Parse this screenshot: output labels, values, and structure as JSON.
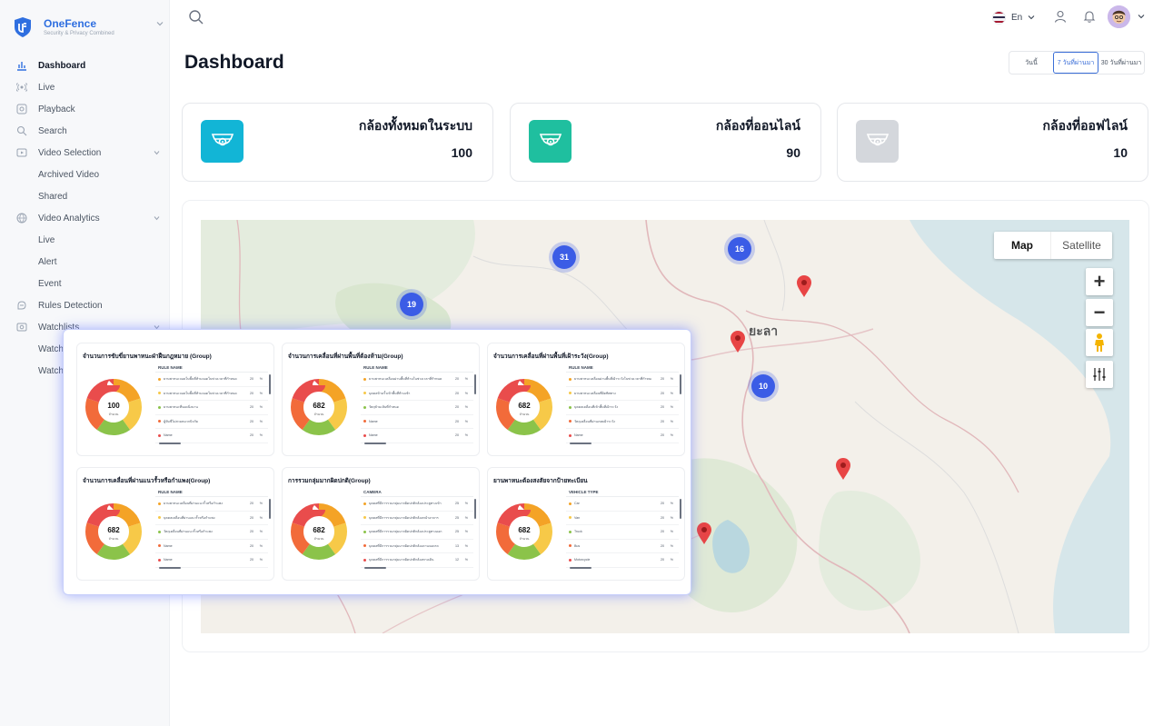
{
  "brand": {
    "name": "OneFence",
    "tagline": "Security & Privacy Combined"
  },
  "sidebar": {
    "items": [
      {
        "label": "Dashboard",
        "icon": "bar-chart-icon",
        "active": true
      },
      {
        "label": "Live",
        "icon": "broadcast-icon"
      },
      {
        "label": "Playback",
        "icon": "playback-icon"
      },
      {
        "label": "Search",
        "icon": "search-icon"
      },
      {
        "label": "Video Selection",
        "icon": "video-selection-icon",
        "expandable": true
      },
      {
        "label": "Archived Video",
        "sub": true
      },
      {
        "label": "Shared",
        "sub": true
      },
      {
        "label": "Video Analytics",
        "icon": "analytics-icon",
        "expandable": true
      },
      {
        "label": "Live",
        "sub": true
      },
      {
        "label": "Alert",
        "sub": true
      },
      {
        "label": "Event",
        "sub": true
      },
      {
        "label": "Rules Detection",
        "icon": "rules-icon"
      },
      {
        "label": "Watchlists",
        "icon": "watchlist-icon",
        "expandable": true
      },
      {
        "label": "Watch",
        "sub": true
      },
      {
        "label": "Watch",
        "sub": true
      }
    ]
  },
  "header": {
    "language": "En"
  },
  "page": {
    "title": "Dashboard"
  },
  "range": {
    "options": [
      "วันนี้",
      "7 วันที่ผ่านมา",
      "30 วันที่ผ่านมา"
    ],
    "selected": 1
  },
  "stats": [
    {
      "label": "กล้องทั้งหมดในระบบ",
      "value": "100",
      "color": "#12b5d6"
    },
    {
      "label": "กล้องที่ออนไลน์",
      "value": "90",
      "color": "#1fbf9f"
    },
    {
      "label": "กล้องที่ออฟไลน์",
      "value": "10",
      "color": "#d4d7dc"
    }
  ],
  "map": {
    "toggle": [
      "Map",
      "Satellite"
    ],
    "city": "ยะลา",
    "clusters": [
      "31",
      "16",
      "19",
      "10"
    ],
    "zoom_in": "+",
    "zoom_out": "−"
  },
  "overlay": {
    "cards": [
      {
        "title": "จำนวนการขับขี่ยานพาหนะฝ่าฝืนกฎหมาย (Group)",
        "column": "RULE NAME",
        "center_value": "100",
        "center_unit": "จำนวน",
        "rows": [
          {
            "name": "ยานพาหนะจอดในพื้นที่ห้ามจอดในช่วงเวลาที่กำหนด",
            "count": "20",
            "pct": "%",
            "color": "#f4a326"
          },
          {
            "name": "ยานพาหนะจอดในพื้นที่ห้ามจอดในช่วงเวลาที่กำหนด",
            "count": "20",
            "pct": "%",
            "color": "#f7c948"
          },
          {
            "name": "ยานพาหนะที่จอดนิ่งนาน",
            "count": "20",
            "pct": "%",
            "color": "#8bc34a"
          },
          {
            "name": "ผู้ขับขี่ไม่สวมหมวกนิรภัย",
            "count": "20",
            "pct": "%",
            "color": "#f26b3a"
          },
          {
            "name": "Name",
            "count": "20",
            "pct": "%",
            "color": "#e94c4c"
          }
        ]
      },
      {
        "title": "จำนวนการเคลื่อนที่ผ่านพื้นที่ต้องห้าม(Group)",
        "column": "RULE NAME",
        "center_value": "682",
        "center_unit": "จำนวน",
        "rows": [
          {
            "name": "ยานพาหนะเคลื่อนผ่านพื้นที่ห้ามในช่วงเวลาที่กำหนด",
            "count": "20",
            "pct": "%",
            "color": "#f4a326"
          },
          {
            "name": "บุคคลข้ามรั้วเข้าพื้นที่ห้ามเข้า",
            "count": "20",
            "pct": "%",
            "color": "#f7c948"
          },
          {
            "name": "วัตถุข้ามเส้นที่กำหนด",
            "count": "20",
            "pct": "%",
            "color": "#8bc34a"
          },
          {
            "name": "Name",
            "count": "20",
            "pct": "%",
            "color": "#f26b3a"
          },
          {
            "name": "Name",
            "count": "20",
            "pct": "%",
            "color": "#e94c4c"
          }
        ]
      },
      {
        "title": "จำนวนการเคลื่อนที่ผ่านพื้นที่เฝ้าระวัง(Group)",
        "column": "RULE NAME",
        "center_value": "682",
        "center_unit": "จำนวน",
        "rows": [
          {
            "name": "ยานพาหนะเคลื่อนผ่านพื้นที่เฝ้าระวังในช่วงเวลาที่กำหนด",
            "count": "20",
            "pct": "%",
            "color": "#f4a326"
          },
          {
            "name": "ยานพาหนะเคลื่อนที่ผิดทิศทาง",
            "count": "20",
            "pct": "%",
            "color": "#f7c948"
          },
          {
            "name": "บุคคลเคลื่อนที่เข้าพื้นที่เฝ้าระวัง",
            "count": "20",
            "pct": "%",
            "color": "#8bc34a"
          },
          {
            "name": "วัตถุเคลื่อนที่ผ่านเขตเฝ้าระวัง",
            "count": "20",
            "pct": "%",
            "color": "#f26b3a"
          },
          {
            "name": "Name",
            "count": "20",
            "pct": "%",
            "color": "#e94c4c"
          }
        ]
      },
      {
        "title": "จำนวนการเคลื่อนที่ผ่านแนวรั้วหรือกำแพง(Group)",
        "column": "RULE NAME",
        "center_value": "682",
        "center_unit": "จำนวน",
        "rows": [
          {
            "name": "ยานพาหนะเคลื่อนที่ผ่านแนวรั้วหรือกำแพง",
            "count": "20",
            "pct": "%",
            "color": "#f4a326"
          },
          {
            "name": "บุคคลเคลื่อนที่ผ่านแนวรั้วหรือกำแพง",
            "count": "20",
            "pct": "%",
            "color": "#f7c948"
          },
          {
            "name": "วัตถุเคลื่อนที่ผ่านแนวรั้วหรือกำแพง",
            "count": "20",
            "pct": "%",
            "color": "#8bc34a"
          },
          {
            "name": "Name",
            "count": "20",
            "pct": "%",
            "color": "#f26b3a"
          },
          {
            "name": "Name",
            "count": "20",
            "pct": "%",
            "color": "#e94c4c"
          }
        ]
      },
      {
        "title": "การรวมกลุ่มมากผิดปกติ(Group)",
        "column": "CAMERA",
        "center_value": "682",
        "center_unit": "จำนวน",
        "rows": [
          {
            "name": "บุคคลที่มีการรวมกลุ่มมากผิดปกติกล้องประตูทางเข้า",
            "count": "25",
            "pct": "%",
            "color": "#f4a326"
          },
          {
            "name": "บุคคลที่มีการรวมกลุ่มมากผิดปกติกล้องหน้าอาคาร",
            "count": "25",
            "pct": "%",
            "color": "#f7c948"
          },
          {
            "name": "บุคคลที่มีการรวมกลุ่มมากผิดปกติกล้องประตูทางออก",
            "count": "25",
            "pct": "%",
            "color": "#8bc34a"
          },
          {
            "name": "บุคคลที่มีการรวมกลุ่มมากผิดปกติกล้องลานจอดรถ",
            "count": "13",
            "pct": "%",
            "color": "#f26b3a"
          },
          {
            "name": "บุคคลที่มีการรวมกลุ่มมากผิดปกติกล้องทางเดิน",
            "count": "12",
            "pct": "%",
            "color": "#e94c4c"
          }
        ]
      },
      {
        "title": "ยานพาหนะต้องสงสัยจากป้ายทะเบียน",
        "column": "VEHICLE TYPE",
        "center_value": "682",
        "center_unit": "จำนวน",
        "rows": [
          {
            "name": "Car",
            "count": "20",
            "pct": "%",
            "color": "#f4a326"
          },
          {
            "name": "Van",
            "count": "20",
            "pct": "%",
            "color": "#f7c948"
          },
          {
            "name": "Truck",
            "count": "20",
            "pct": "%",
            "color": "#8bc34a"
          },
          {
            "name": "Bus",
            "count": "20",
            "pct": "%",
            "color": "#f26b3a"
          },
          {
            "name": "Motorcycle",
            "count": "20",
            "pct": "%",
            "color": "#e94c4c"
          }
        ]
      }
    ]
  }
}
